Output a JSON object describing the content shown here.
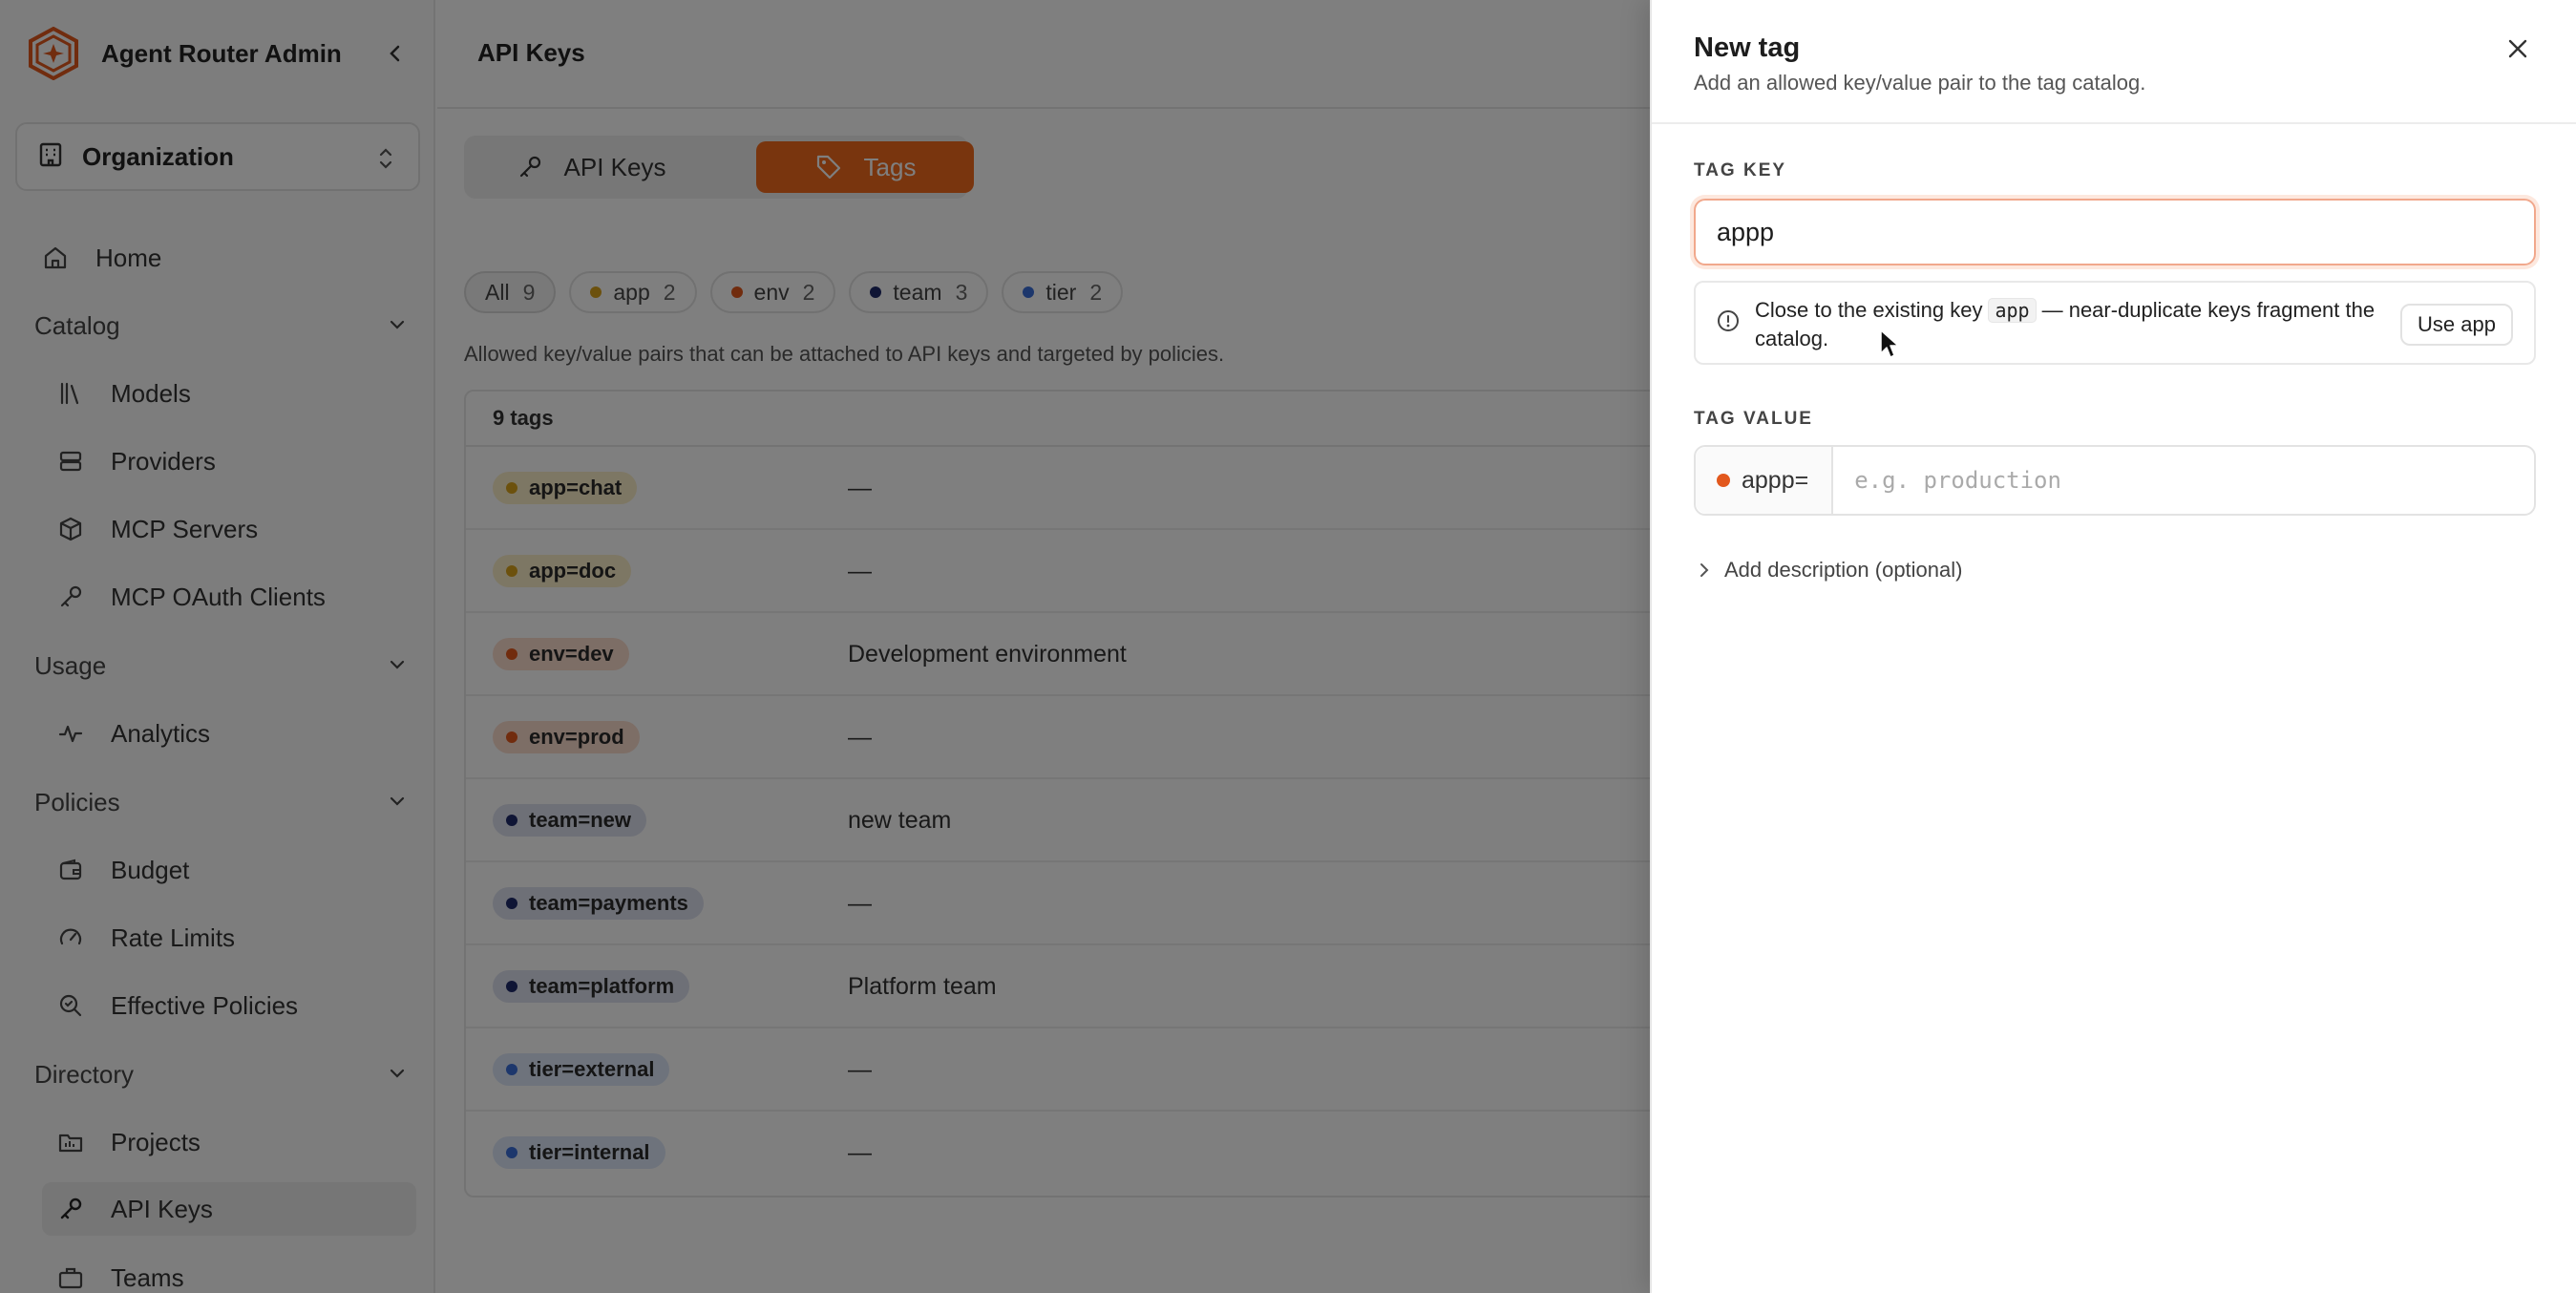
{
  "app": {
    "name": "Agent Router Admin"
  },
  "org_selector": {
    "label": "Organization"
  },
  "nav": {
    "home": "Home",
    "catalog": "Catalog",
    "models": "Models",
    "providers": "Providers",
    "mcp_servers": "MCP Servers",
    "mcp_oauth_clients": "MCP OAuth Clients",
    "usage": "Usage",
    "analytics": "Analytics",
    "policies": "Policies",
    "budget": "Budget",
    "rate_limits": "Rate Limits",
    "effective_policies": "Effective Policies",
    "directory": "Directory",
    "projects": "Projects",
    "api_keys": "API Keys",
    "teams": "Teams"
  },
  "page": {
    "title": "API Keys"
  },
  "tabs": {
    "api_keys": "API Keys",
    "tags": "Tags"
  },
  "filters": [
    {
      "label": "All",
      "count": "9",
      "color": ""
    },
    {
      "label": "app",
      "count": "2",
      "color": "#d9a21b"
    },
    {
      "label": "env",
      "count": "2",
      "color": "#e2581d"
    },
    {
      "label": "team",
      "count": "3",
      "color": "#1f2a6b"
    },
    {
      "label": "tier",
      "count": "2",
      "color": "#3b6fd9"
    }
  ],
  "description": "Allowed key/value pairs that can be attached to API keys and targeted by policies.",
  "table": {
    "header": "9 tags",
    "rows": [
      {
        "tag": "app=chat",
        "desc": "—",
        "color": "#d9a21b",
        "bg": "#fbeec9"
      },
      {
        "tag": "app=doc",
        "desc": "—",
        "color": "#d9a21b",
        "bg": "#fbeec9"
      },
      {
        "tag": "env=dev",
        "desc": "Development environment",
        "color": "#e2581d",
        "bg": "#fbdccd"
      },
      {
        "tag": "env=prod",
        "desc": "—",
        "color": "#e2581d",
        "bg": "#fbdccd"
      },
      {
        "tag": "team=new",
        "desc": "new team",
        "color": "#1f2a6b",
        "bg": "#dde0ee"
      },
      {
        "tag": "team=payments",
        "desc": "—",
        "color": "#1f2a6b",
        "bg": "#dde0ee"
      },
      {
        "tag": "team=platform",
        "desc": "Platform team",
        "color": "#1f2a6b",
        "bg": "#dde0ee"
      },
      {
        "tag": "tier=external",
        "desc": "—",
        "color": "#3b6fd9",
        "bg": "#dce6f8"
      },
      {
        "tag": "tier=internal",
        "desc": "—",
        "color": "#3b6fd9",
        "bg": "#dce6f8"
      }
    ]
  },
  "drawer": {
    "title": "New tag",
    "subtitle": "Add an allowed key/value pair to the tag catalog.",
    "tag_key_label": "TAG KEY",
    "tag_key_value": "appp",
    "warning_pre": "Close to the existing key",
    "warning_code": "app",
    "warning_post": "— near-duplicate keys fragment the catalog.",
    "use_button": "Use app",
    "tag_value_label": "TAG VALUE",
    "value_prefix": "appp=",
    "value_placeholder": "e.g. production",
    "add_description": "Add description (optional)"
  },
  "colors": {
    "accent": "#f26b1d"
  }
}
